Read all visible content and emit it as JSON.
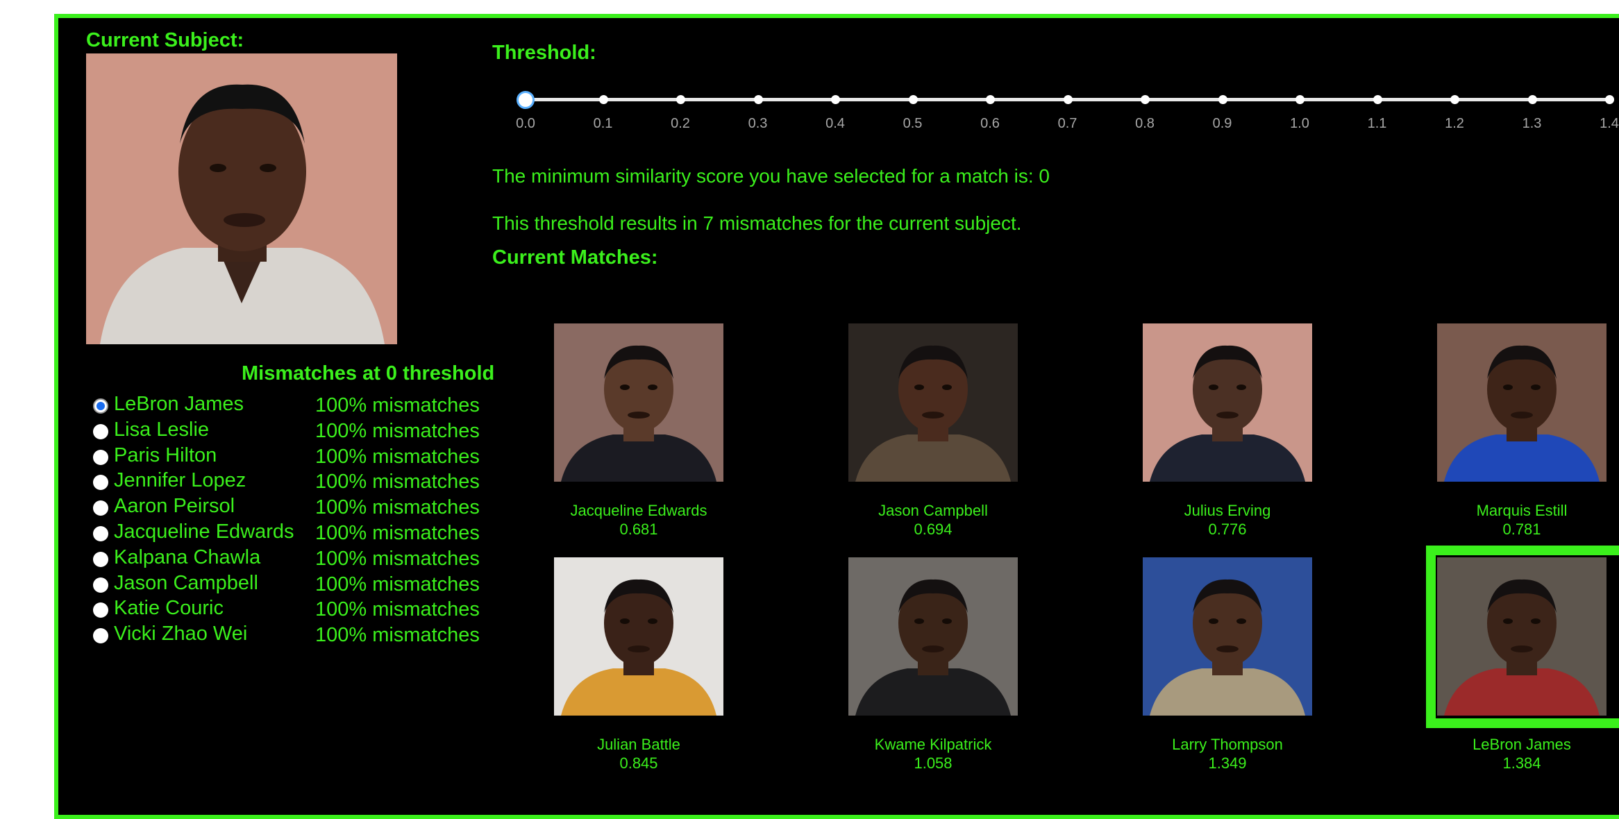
{
  "subject": {
    "heading": "Current Subject:",
    "photo_icon": "portrait-lebron-james"
  },
  "threshold": {
    "heading": "Threshold:",
    "value": 0,
    "ticks": [
      "0.0",
      "0.1",
      "0.2",
      "0.3",
      "0.4",
      "0.5",
      "0.6",
      "0.7",
      "0.8",
      "0.9",
      "1.0",
      "1.1",
      "1.2",
      "1.3",
      "1.4"
    ],
    "min_score_text": "The minimum similarity score you have selected for a match is: 0",
    "mismatch_text": "This threshold results in 7 mismatches for the current subject."
  },
  "matches_heading": "Current Matches:",
  "mismatch_list": {
    "heading": "Mismatches at 0 threshold",
    "items": [
      {
        "name": "LeBron James",
        "pct": "100% mismatches",
        "selected": true
      },
      {
        "name": "Lisa Leslie",
        "pct": "100% mismatches",
        "selected": false
      },
      {
        "name": "Paris Hilton",
        "pct": "100% mismatches",
        "selected": false
      },
      {
        "name": "Jennifer Lopez",
        "pct": "100% mismatches",
        "selected": false
      },
      {
        "name": "Aaron Peirsol",
        "pct": "100% mismatches",
        "selected": false
      },
      {
        "name": "Jacqueline Edwards",
        "pct": "100% mismatches",
        "selected": false
      },
      {
        "name": "Kalpana Chawla",
        "pct": "100% mismatches",
        "selected": false
      },
      {
        "name": "Jason Campbell",
        "pct": "100% mismatches",
        "selected": false
      },
      {
        "name": "Katie Couric",
        "pct": "100% mismatches",
        "selected": false
      },
      {
        "name": "Vicki Zhao Wei",
        "pct": "100% mismatches",
        "selected": false
      }
    ]
  },
  "matches": [
    {
      "name": "Jacqueline Edwards",
      "score": "0.681",
      "bg": "#8a6a62",
      "skin": "#5a3a2a",
      "shirt": "#1b1b22"
    },
    {
      "name": "Jason Campbell",
      "score": "0.694",
      "bg": "#2c2622",
      "skin": "#4a2b1e",
      "shirt": "#5a4a3a"
    },
    {
      "name": "Julius Erving",
      "score": "0.776",
      "bg": "#c9968a",
      "skin": "#4b3024",
      "shirt": "#1e2230"
    },
    {
      "name": "Marquis Estill",
      "score": "0.781",
      "bg": "#7a5a4e",
      "skin": "#3e2418",
      "shirt": "#1f48b8"
    },
    {
      "name": "Julian Battle",
      "score": "0.845",
      "bg": "#e4e2df",
      "skin": "#3a2218",
      "shirt": "#d99a33"
    },
    {
      "name": "Kwame Kilpatrick",
      "score": "1.058",
      "bg": "#6e6a66",
      "skin": "#3a2418",
      "shirt": "#1c1c1e"
    },
    {
      "name": "Larry Thompson",
      "score": "1.349",
      "bg": "#2d4f9a",
      "skin": "#4a2e20",
      "shirt": "#a89a7e"
    },
    {
      "name": "LeBron James",
      "score": "1.384",
      "bg": "#5e564e",
      "skin": "#3c2419",
      "shirt": "#9b2a2a"
    }
  ],
  "colors": {
    "accent": "#3bf01c",
    "background": "#000000",
    "slider_handle_border": "#5ab0ff"
  }
}
